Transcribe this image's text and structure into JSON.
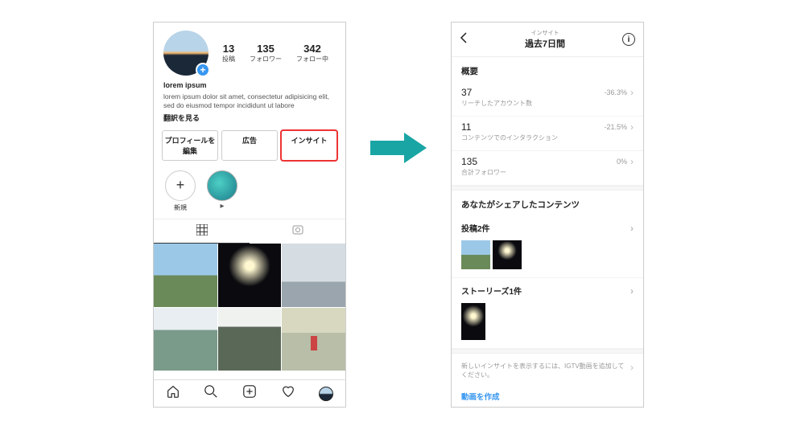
{
  "profile": {
    "stats": {
      "posts": {
        "num": "13",
        "label": "投稿"
      },
      "followers": {
        "num": "135",
        "label": "フォロワー"
      },
      "following": {
        "num": "342",
        "label": "フォロー中"
      }
    },
    "name": "lorem ipsum",
    "desc": "lorem ipsum dolor sit amet, consectetur adipisicing elit, sed do eiusmod tempor incididunt ut labore",
    "translate": "翻訳を見る",
    "buttons": {
      "edit": "プロフィールを編集",
      "ads": "広告",
      "insights": "インサイト"
    },
    "story_new": "新規"
  },
  "insights": {
    "header": {
      "small": "インサイト",
      "big": "過去7日間"
    },
    "overview_title": "概要",
    "metrics": {
      "reach": {
        "num": "37",
        "label": "リーチしたアカウント数",
        "delta": "-36.3%"
      },
      "interactions": {
        "num": "11",
        "label": "コンテンツでのインタラクション",
        "delta": "-21.5%"
      },
      "followers": {
        "num": "135",
        "label": "合計フォロワー",
        "delta": "0%"
      }
    },
    "shared_title": "あなたがシェアしたコンテンツ",
    "posts_row": "投稿2件",
    "stories_row": "ストーリーズ1件",
    "igtv_note": "新しいインサイトを表示するには、IGTV動画を追加してください。",
    "create_video": "動画を作成"
  }
}
